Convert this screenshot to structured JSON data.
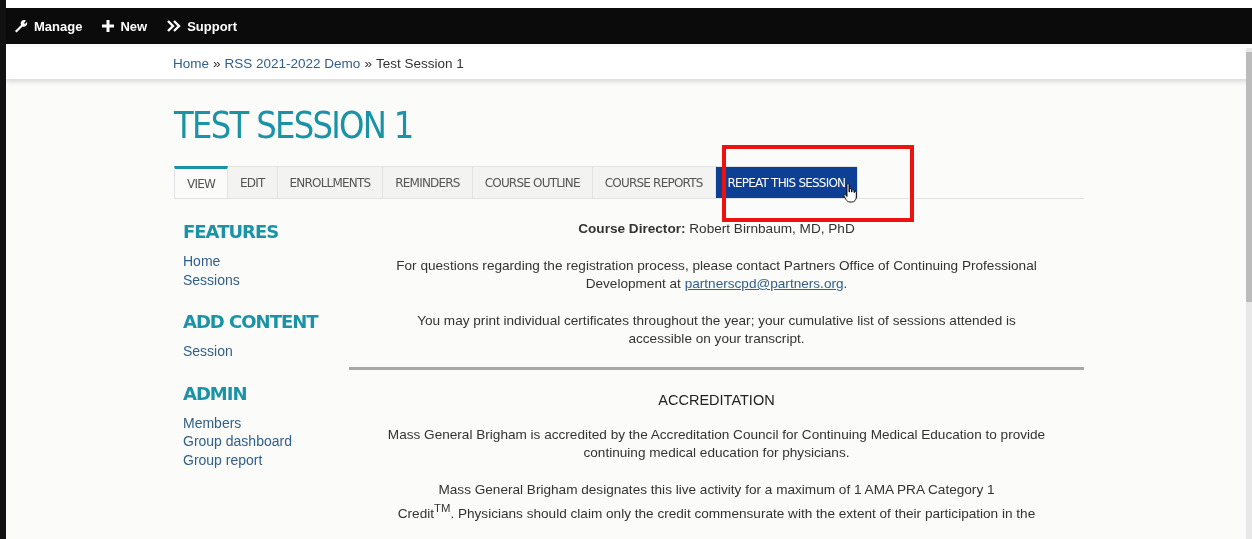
{
  "toolbar": {
    "items": [
      {
        "kind": "wrench",
        "label": "Manage"
      },
      {
        "kind": "plus",
        "label": "New"
      },
      {
        "kind": "chevrons",
        "label": "Support"
      }
    ]
  },
  "breadcrumb": [
    {
      "label": "Home",
      "link": true
    },
    {
      "label": "»",
      "link": false
    },
    {
      "label": "RSS 2021-2022 Demo",
      "link": true
    },
    {
      "label": "»",
      "link": false
    },
    {
      "label": "Test Session 1",
      "link": false
    }
  ],
  "page_title": "TEST SESSION 1",
  "tabs": [
    {
      "label": "VIEW",
      "selected": true,
      "kind": "plain"
    },
    {
      "label": "EDIT",
      "selected": false,
      "kind": "plain"
    },
    {
      "label": "ENROLLMENTS",
      "selected": false,
      "kind": "plain"
    },
    {
      "label": "REMINDERS",
      "selected": false,
      "kind": "plain"
    },
    {
      "label": "COURSE OUTLINE",
      "selected": false,
      "kind": "plain"
    },
    {
      "label": "COURSE REPORTS",
      "selected": false,
      "kind": "plain"
    },
    {
      "label": "REPEAT THIS SESSION",
      "selected": false,
      "kind": "action"
    }
  ],
  "sidebar": [
    {
      "heading": "FEATURES",
      "links": [
        "Home",
        "Sessions"
      ]
    },
    {
      "heading": "ADD CONTENT",
      "links": [
        "Session"
      ]
    },
    {
      "heading": "ADMIN",
      "links": [
        "Members",
        "Group dashboard",
        "Group report"
      ]
    }
  ],
  "content": [
    {
      "kind": "para",
      "lines": [
        {
          "text": "**Course Director:** Robert Birnbaum, MD, PhD"
        }
      ]
    },
    {
      "kind": "para",
      "lines": [
        {
          "text": "For questions regarding the registration process, please contact Partners Office of Continuing Professional"
        },
        {
          "text": "Development at ",
          "link": "partnerscpd@partners.org",
          "after": "."
        }
      ]
    },
    {
      "kind": "para",
      "lines": [
        {
          "text": "You may print individual certificates throughout the year; your cumulative list of sessions attended is"
        },
        {
          "text": "accessible on your transcript."
        }
      ]
    },
    {
      "kind": "rule"
    },
    {
      "kind": "heading",
      "lines": [
        {
          "text": "ACCREDITATION"
        }
      ]
    },
    {
      "kind": "para",
      "lines": [
        {
          "text": "Mass General Brigham is accredited by the Accreditation Council for Continuing Medical Education to provide"
        },
        {
          "text": "continuing medical education for physicians."
        }
      ]
    },
    {
      "kind": "para",
      "lines": [
        {
          "text": "Mass General Brigham designates this live activity for a maximum of 1 AMA PRA Category 1"
        },
        {
          "text": "Credit$^{TM}$. Physicians should claim only the credit commensurate with the extent of their participation in the"
        }
      ]
    }
  ]
}
